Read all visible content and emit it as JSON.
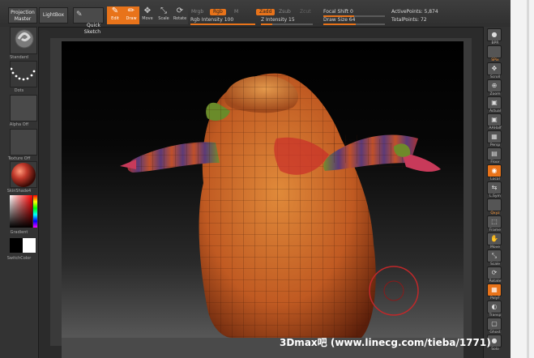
{
  "toolbar": {
    "projection_master": "Projection\nMaster",
    "lightbox": "LightBox",
    "quick_sketch": "Quick\nSketch",
    "edit": "Edit",
    "draw": "Draw",
    "move": "Move",
    "scale": "Scale",
    "rotate": "Rotate",
    "mrgb": "Mrgb",
    "rgb": "Rgb",
    "m": "M",
    "rgb_intensity": "Rgb Intensity 100",
    "zadd": "Zadd",
    "zsub": "Zsub",
    "zcut": "Zcut",
    "z_intensity": "Z Intensity 15",
    "focal_shift": "Focal Shift 0",
    "draw_size": "Draw Size 64",
    "active_points": "ActivePoints: 5,874",
    "total_points": "TotalPoints: 72"
  },
  "left_shelf": {
    "brush_label": "Standard",
    "stroke_label": "Dots",
    "alpha_label": "Alpha Off",
    "texture_label": "Texture Off",
    "material_label": "SkinShade4",
    "gradient_label": "Gradient",
    "switch_color_label": "SwitchColor"
  },
  "right_shelf": [
    {
      "icon": "bpr-icon",
      "glyph": "●",
      "label": "BPR"
    },
    {
      "icon": "spix-icon",
      "glyph": "",
      "label": "SPix"
    },
    {
      "icon": "scroll-icon",
      "glyph": "✥",
      "label": "Scroll"
    },
    {
      "icon": "zoom-icon",
      "glyph": "⊕",
      "label": "Zoom"
    },
    {
      "icon": "actual-icon",
      "glyph": "▣",
      "label": "Actual"
    },
    {
      "icon": "aahalf-icon",
      "glyph": "▣",
      "label": "AAHalf"
    },
    {
      "icon": "persp-icon",
      "glyph": "▦",
      "label": "Persp"
    },
    {
      "icon": "floor-icon",
      "glyph": "▤",
      "label": "Floor"
    },
    {
      "icon": "local-icon",
      "glyph": "◉",
      "label": "Local"
    },
    {
      "icon": "lsym-icon",
      "glyph": "⇆",
      "label": "L.Sym"
    },
    {
      "icon": "xyz-icon",
      "glyph": "",
      "label": "Qxyz"
    },
    {
      "icon": "frame-icon",
      "glyph": "⬚",
      "label": "Frame"
    },
    {
      "icon": "move-icon",
      "glyph": "✋",
      "label": "Move"
    },
    {
      "icon": "scale-icon",
      "glyph": "⤡",
      "label": "Scale"
    },
    {
      "icon": "rotate-icon",
      "glyph": "⟳",
      "label": "Rotate"
    },
    {
      "icon": "polyf-icon",
      "glyph": "▦",
      "label": "PolyF"
    },
    {
      "icon": "transp-icon",
      "glyph": "◐",
      "label": "Transp"
    },
    {
      "icon": "ghost-icon",
      "glyph": "▢",
      "label": "Ghost"
    },
    {
      "icon": "solo-icon",
      "glyph": "●",
      "label": "Solo"
    }
  ],
  "watermark": "3Dmax吧 (www.linecg.com/tieba/1771)",
  "colors": {
    "accent": "#e8731a",
    "toolbar_bg": "#333333",
    "model_orange": "#d2691e",
    "model_stripe_purple": "#5b3a78"
  }
}
